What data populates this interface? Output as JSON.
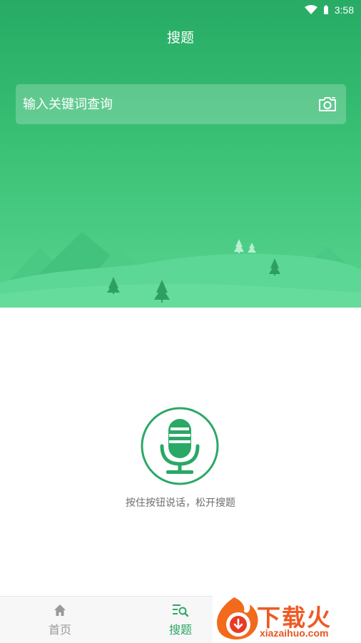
{
  "status_bar": {
    "time": "3:58",
    "wifi_icon": "wifi-icon",
    "battery_icon": "battery-icon"
  },
  "header": {
    "title": "搜题"
  },
  "search": {
    "placeholder": "输入关键词查询",
    "camera_icon": "camera-icon"
  },
  "voice": {
    "icon": "microphone-icon",
    "hint": "按住按钮说话，松开搜题"
  },
  "tabbar": {
    "items": [
      {
        "label": "首页",
        "icon": "home-icon",
        "active": false
      },
      {
        "label": "搜题",
        "icon": "search-list-icon",
        "active": true
      }
    ]
  },
  "watermark": {
    "title": "下载火",
    "url": "xiazaihuo.com"
  },
  "colors": {
    "primary": "#2aa866",
    "hero_top": "#27ab65",
    "hero_bottom": "#57d48f",
    "hint_text": "#6e6e6e"
  }
}
